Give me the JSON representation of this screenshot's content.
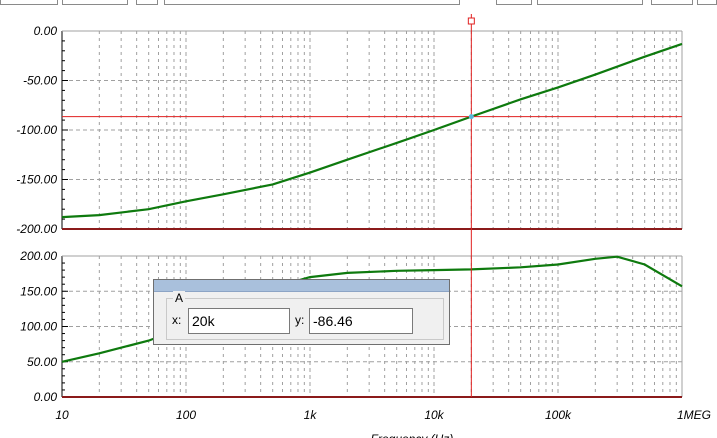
{
  "colors": {
    "grid": "#a0a0a0",
    "trace": "#0e7a0e",
    "cursor_line": "#e02020",
    "axis": "#000000",
    "dialog_title": "#a9c0dc"
  },
  "chart_data": [
    {
      "type": "line",
      "xscale": "log",
      "xlim": [
        10,
        1000000
      ],
      "ylim": [
        -200,
        0
      ],
      "yticks": [
        "0.00",
        "-50.00",
        "-100.00",
        "-150.00",
        "-200.00"
      ],
      "grid": true,
      "series": [
        {
          "x": [
            10,
            20,
            50,
            100,
            200,
            500,
            1000,
            2000,
            5000,
            10000,
            20000,
            50000,
            100000,
            200000,
            500000,
            1000000
          ],
          "y": [
            -188,
            -186,
            -180,
            -172,
            -165,
            -155,
            -143,
            -130,
            -113,
            -100,
            -86.5,
            -69,
            -57,
            -44,
            -26,
            -13
          ]
        }
      ]
    },
    {
      "type": "line",
      "xscale": "log",
      "xlim": [
        10,
        1000000
      ],
      "ylim": [
        0,
        200
      ],
      "yticks": [
        "200.00",
        "150.00",
        "100.00",
        "50.00",
        "0.00"
      ],
      "xticks": [
        "10",
        "100",
        "1k",
        "10k",
        "100k",
        "1MEG"
      ],
      "xlabel": "Frequency (Hz)",
      "grid": true,
      "series": [
        {
          "x": [
            10,
            20,
            50,
            100,
            200,
            500,
            1000,
            2000,
            5000,
            10000,
            20000,
            50000,
            100000,
            200000,
            300000,
            500000,
            1000000
          ],
          "y": [
            50,
            62,
            80,
            100,
            128,
            155,
            170,
            176,
            179,
            180,
            181,
            184,
            188,
            196,
            199,
            188,
            157
          ]
        }
      ]
    }
  ],
  "cursor": {
    "x_value": 20000,
    "y_value": -86.46
  },
  "cursor_box": {
    "group_label": "A",
    "x_label": "x:",
    "x_value": "20k",
    "y_label": "y:",
    "y_value": "-86.46"
  }
}
